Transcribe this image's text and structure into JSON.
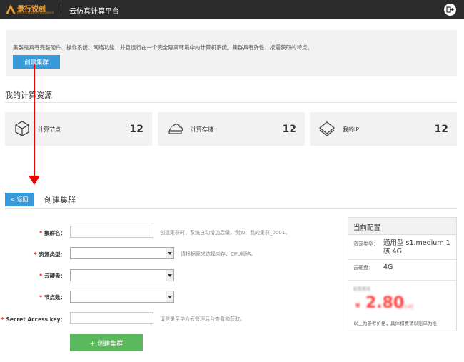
{
  "header": {
    "logo_text": "景行锐创",
    "logo_sub": "JH Innovation Software",
    "title": "云仿真计算平台",
    "logout_icon": "logout-icon"
  },
  "intro": {
    "text": "集群是具有完整硬件、操作系统、网络功能，并且运行在一个完全隔离环境中的计算机系统。集群具有弹性、按需获取的特点。",
    "create_label": "创建集群"
  },
  "resources": {
    "title": "我的计算资源",
    "cards": [
      {
        "icon": "cube-icon",
        "label": "计算节点",
        "value": "12"
      },
      {
        "icon": "cloud-storage-icon",
        "label": "计算存储",
        "value": "12"
      },
      {
        "icon": "layers-icon",
        "label": "我的IP",
        "value": "12"
      }
    ]
  },
  "annotation": {
    "color": "#e00000",
    "shape": "arrow-down"
  },
  "form": {
    "back_label": "< 返回",
    "title": "创建集群",
    "rows": [
      {
        "label": "集群名：",
        "type": "input",
        "value": "",
        "hint": "创建集群时，系统自动增加后缀，例如：我的集群_0001。"
      },
      {
        "label": "资源类型：",
        "type": "select",
        "value": "",
        "hint": "请根据需求选择内存、CPU规格。"
      },
      {
        "label": "云硬盘：",
        "type": "select",
        "value": "",
        "hint": ""
      },
      {
        "label": "节点数：",
        "type": "select",
        "value": "",
        "hint": ""
      },
      {
        "label": "Secret Access key：",
        "type": "input",
        "value": "",
        "hint": "请登录至华为云管理后台查看和获取。"
      }
    ],
    "submit_label": "+ 创建集群"
  },
  "config": {
    "title": "当前配置",
    "items": [
      {
        "label": "资源类型：",
        "value": "通用型 s1.medium 1核 4G"
      },
      {
        "label": "云硬盘：",
        "value": "4G"
      }
    ],
    "price": "2.80",
    "price_prefix": "¥",
    "price_unit": "元/小时",
    "price_label": "配置费用",
    "note": "以上为参考价格，具体扣费请以账单为准"
  },
  "colors": {
    "primary": "#3a9ad9",
    "success": "#5cb85c",
    "price": "#ff4040"
  }
}
